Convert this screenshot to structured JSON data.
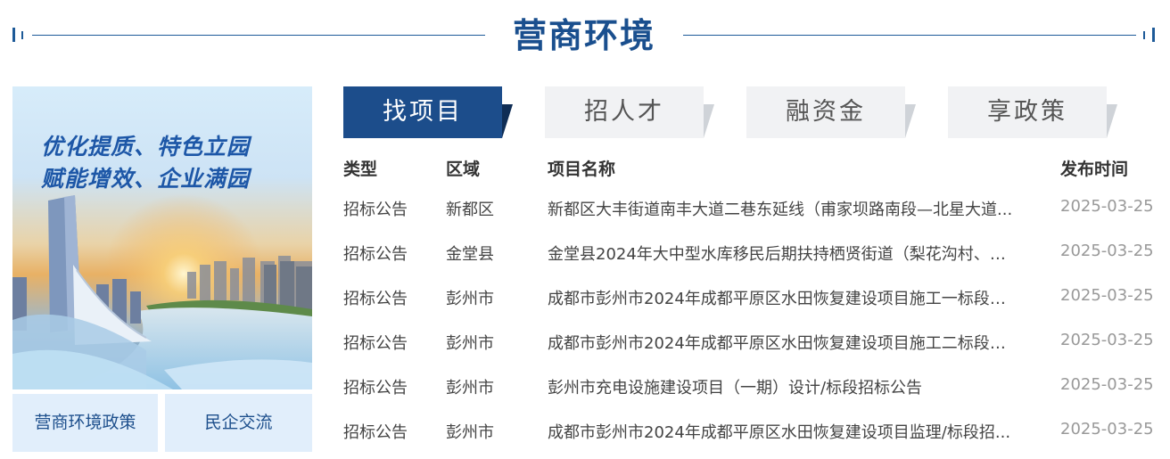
{
  "section": {
    "title": "营商环境"
  },
  "banner": {
    "slogan_line1": "优化提质、特色立园",
    "slogan_line2": "赋能增效、企业满园"
  },
  "quick_links": [
    {
      "label": "营商环境政策"
    },
    {
      "label": "民企交流"
    }
  ],
  "tabs": [
    {
      "label": "找项目",
      "active": true
    },
    {
      "label": "招人才",
      "active": false
    },
    {
      "label": "融资金",
      "active": false
    },
    {
      "label": "享政策",
      "active": false
    }
  ],
  "table": {
    "headers": {
      "type": "类型",
      "area": "区域",
      "name": "项目名称",
      "date": "发布时间"
    },
    "rows": [
      {
        "type": "招标公告",
        "area": "新都区",
        "name": "新都区大丰街道南丰大道二巷东延线（甫家坝路南段—北星大道...",
        "date": "2025-03-25"
      },
      {
        "type": "招标公告",
        "area": "金堂县",
        "name": "金堂县2024年大中型水库移民后期扶持栖贤街道（梨花沟村、盐...",
        "date": "2025-03-25"
      },
      {
        "type": "招标公告",
        "area": "彭州市",
        "name": "成都市彭州市2024年成都平原区水田恢复建设项目施工一标段招...",
        "date": "2025-03-25"
      },
      {
        "type": "招标公告",
        "area": "彭州市",
        "name": "成都市彭州市2024年成都平原区水田恢复建设项目施工二标段招...",
        "date": "2025-03-25"
      },
      {
        "type": "招标公告",
        "area": "彭州市",
        "name": "彭州市充电设施建设项目（一期）设计/标段招标公告",
        "date": "2025-03-25"
      },
      {
        "type": "招标公告",
        "area": "彭州市",
        "name": "成都市彭州市2024年成都平原区水田恢复建设项目监理/标段招...",
        "date": "2025-03-25"
      }
    ]
  },
  "colors": {
    "primary": "#1c4d8b",
    "light_blue": "#e1eefb",
    "tab_gray": "#f1f2f4"
  }
}
